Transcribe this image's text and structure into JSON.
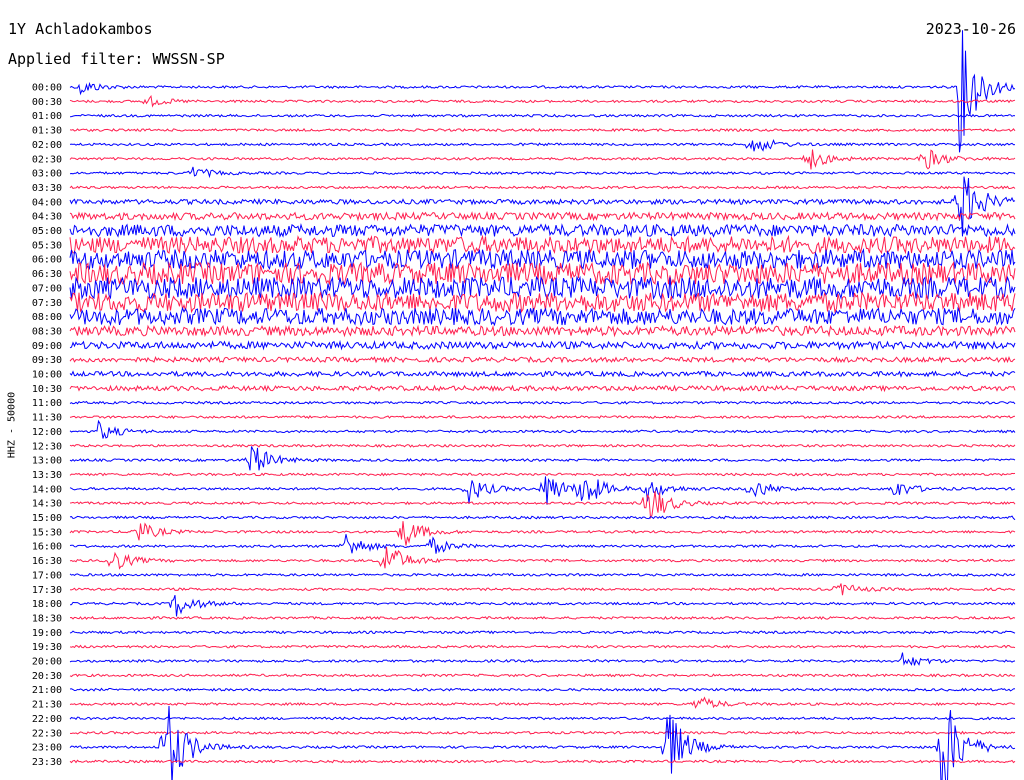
{
  "header": {
    "station": "1Y Achladokambos",
    "date": "2023-10-26",
    "filter": "Applied filter: WWSSN-SP"
  },
  "channel_label": "HHZ - 50000",
  "colors": {
    "even": "#0000ff",
    "odd": "#ff1f4f",
    "background": "#ffffff"
  },
  "chart_data": {
    "type": "line",
    "title": "1Y Achladokambos",
    "subtitle": "Applied filter: WWSSN-SP",
    "ylabel": "HHZ - 50000",
    "xlabel": "",
    "row_labels": [
      "00:00",
      "00:30",
      "01:00",
      "01:30",
      "02:00",
      "02:30",
      "03:00",
      "03:30",
      "04:00",
      "04:30",
      "05:00",
      "05:30",
      "06:00",
      "06:30",
      "07:00",
      "07:30",
      "08:00",
      "08:30",
      "09:00",
      "09:30",
      "10:00",
      "10:30",
      "11:00",
      "11:30",
      "12:00",
      "12:30",
      "13:00",
      "13:30",
      "14:00",
      "14:30",
      "15:00",
      "15:30",
      "16:00",
      "16:30",
      "17:00",
      "17:30",
      "18:00",
      "18:30",
      "19:00",
      "19:30",
      "20:00",
      "20:30",
      "21:00",
      "21:30",
      "22:00",
      "22:30",
      "23:00",
      "23:30"
    ],
    "row_amplitude": [
      1,
      1,
      1,
      1,
      1,
      1,
      1,
      1,
      2,
      3,
      5,
      7,
      8,
      9,
      9,
      8,
      7,
      4,
      3,
      2,
      2,
      2,
      1,
      1,
      1,
      1,
      1,
      1,
      1,
      1,
      1,
      1,
      1,
      1,
      1,
      1,
      1,
      1,
      1,
      1,
      1,
      1,
      1,
      1,
      1,
      1,
      1,
      1
    ],
    "events": [
      {
        "row": 0,
        "t": 0.01,
        "amp": 8
      },
      {
        "row": 1,
        "t": 0.08,
        "amp": 6
      },
      {
        "row": 4,
        "t": 0.72,
        "amp": 12
      },
      {
        "row": 5,
        "t": 0.78,
        "amp": 12
      },
      {
        "row": 5,
        "t": 0.9,
        "amp": 15
      },
      {
        "row": 6,
        "t": 0.13,
        "amp": 6
      },
      {
        "row": 8,
        "t": 0.94,
        "amp": 40
      },
      {
        "row": 0,
        "t": 0.94,
        "amp": 70
      },
      {
        "row": 24,
        "t": 0.03,
        "amp": 10
      },
      {
        "row": 26,
        "t": 0.19,
        "amp": 20
      },
      {
        "row": 28,
        "t": 0.42,
        "amp": 15
      },
      {
        "row": 28,
        "t": 0.5,
        "amp": 22
      },
      {
        "row": 28,
        "t": 0.54,
        "amp": 22
      },
      {
        "row": 28,
        "t": 0.61,
        "amp": 12
      },
      {
        "row": 28,
        "t": 0.72,
        "amp": 12
      },
      {
        "row": 28,
        "t": 0.87,
        "amp": 10
      },
      {
        "row": 29,
        "t": 0.61,
        "amp": 25
      },
      {
        "row": 30,
        "t": 1.0,
        "amp": 10
      },
      {
        "row": 31,
        "t": 0.07,
        "amp": 12
      },
      {
        "row": 31,
        "t": 0.35,
        "amp": 18
      },
      {
        "row": 32,
        "t": 0.29,
        "amp": 15
      },
      {
        "row": 32,
        "t": 0.38,
        "amp": 10
      },
      {
        "row": 33,
        "t": 0.04,
        "amp": 15
      },
      {
        "row": 33,
        "t": 0.33,
        "amp": 25
      },
      {
        "row": 36,
        "t": 0.11,
        "amp": 15
      },
      {
        "row": 35,
        "t": 0.81,
        "amp": 8
      },
      {
        "row": 40,
        "t": 0.88,
        "amp": 8
      },
      {
        "row": 43,
        "t": 0.66,
        "amp": 10
      },
      {
        "row": 46,
        "t": 0.1,
        "amp": 60
      },
      {
        "row": 46,
        "t": 0.63,
        "amp": 45
      },
      {
        "row": 46,
        "t": 0.92,
        "amp": 70
      }
    ],
    "ylim": [
      -1,
      1
    ]
  }
}
